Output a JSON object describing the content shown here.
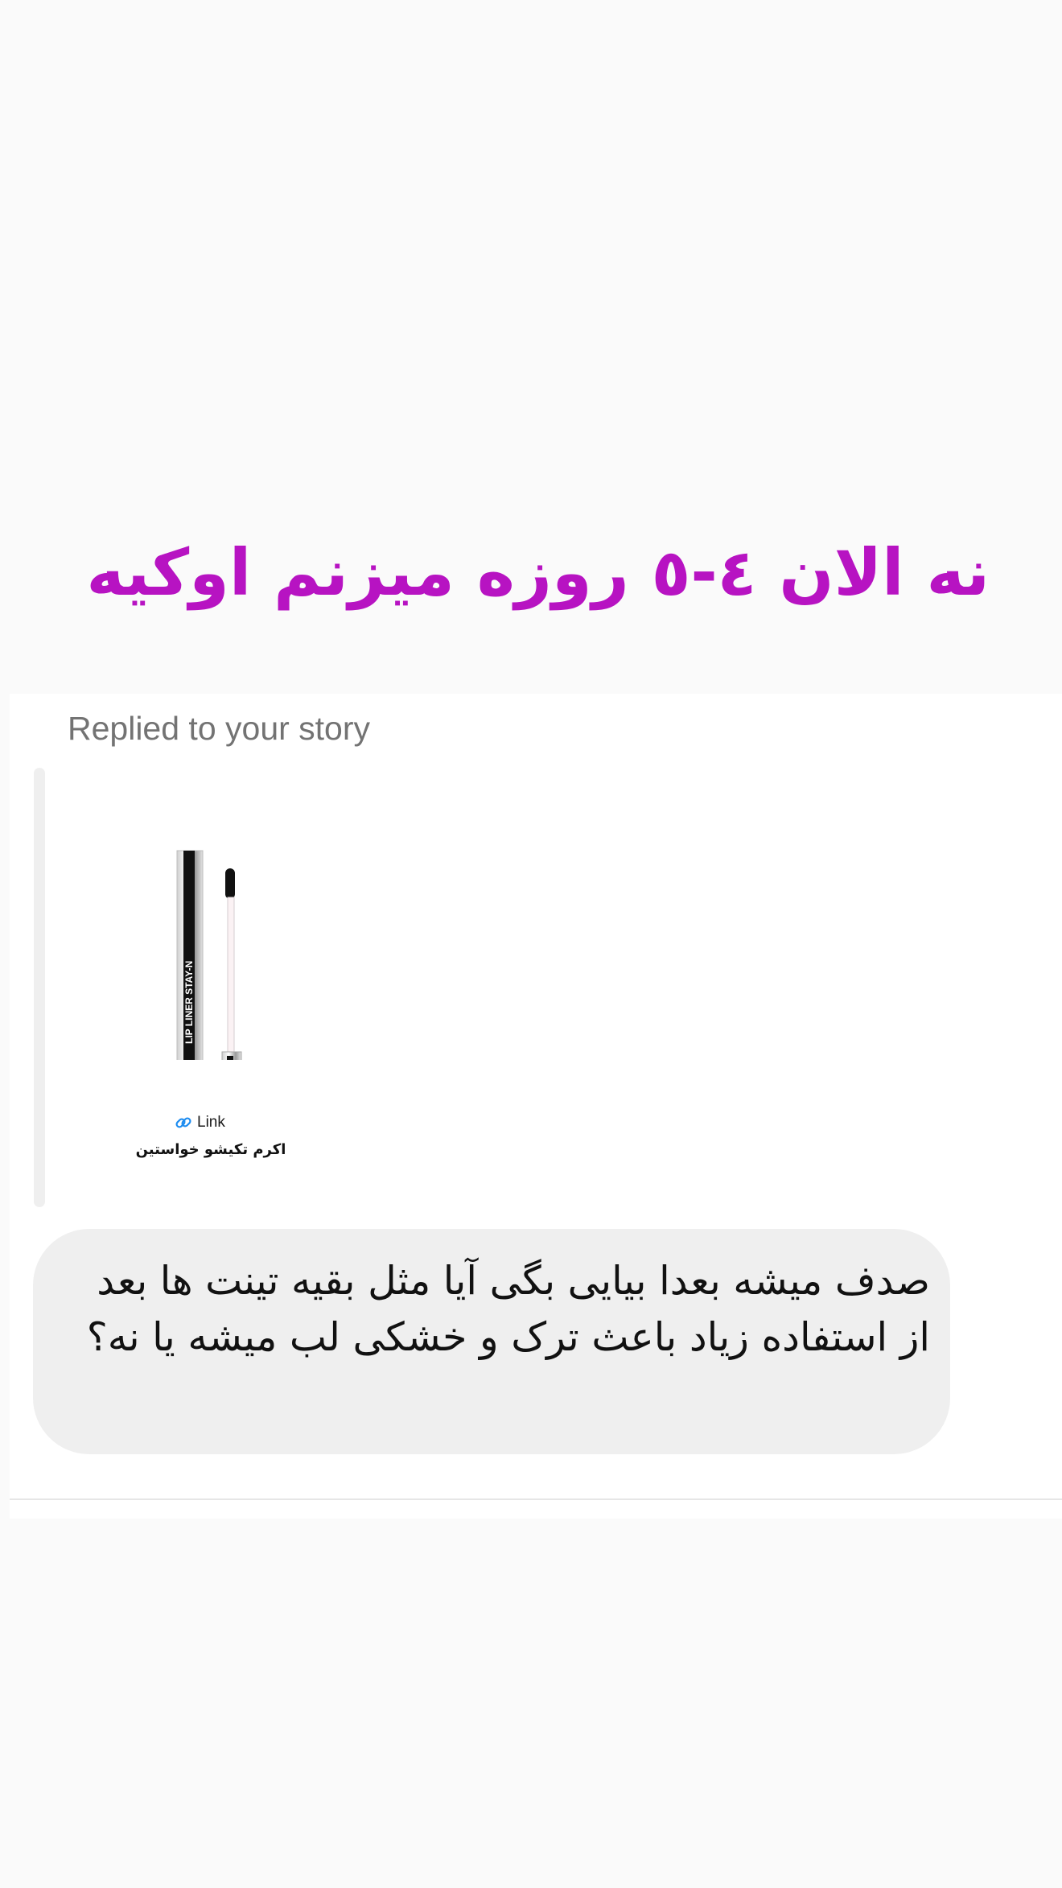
{
  "story_overlay": {
    "text": "نه الان ٤-٥ روزه میزنم اوکیه",
    "color": "#b713c2"
  },
  "reply": {
    "label": "Replied to your story",
    "story": {
      "product_text": "LIP LINER STAY-N",
      "link_label": "Link",
      "caption": "اکرم تکیشو خواستین"
    },
    "message": "صدف میشه بعدا بیایی بگی آیا مثل بقیه تینت ها بعد از استفاده زیاد باعث ترک و خشکی لب میشه یا نه؟"
  },
  "colors": {
    "page_background": "#fafafa",
    "bubble": "#efefef",
    "label_gray": "#737373",
    "link_icon": "#1d8cf0"
  }
}
